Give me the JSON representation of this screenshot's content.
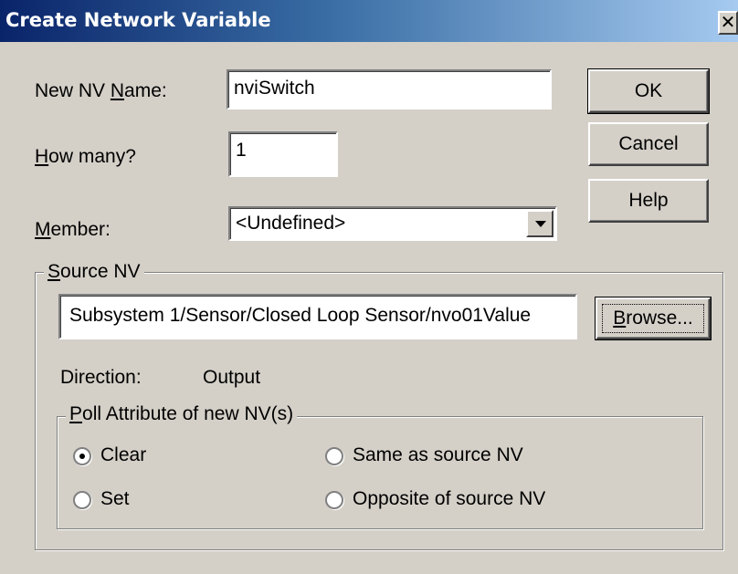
{
  "window": {
    "title": "Create Network Variable",
    "close_glyph": "✕"
  },
  "form": {
    "name_label_prefix": "New NV ",
    "name_label_mnemonic": "N",
    "name_label_suffix": "ame:",
    "name_value": "nviSwitch",
    "howmany_label_mnemonic": "H",
    "howmany_label_suffix": "ow many?",
    "howmany_value": "1",
    "member_label_mnemonic": "M",
    "member_label_suffix": "ember:",
    "member_selected": "<Undefined>"
  },
  "buttons": {
    "ok": "OK",
    "cancel": "Cancel",
    "help": "Help",
    "browse_mnemonic": "B",
    "browse_suffix": "rowse..."
  },
  "source_nv": {
    "group_mnemonic": "S",
    "group_suffix": "ource NV",
    "path": "Subsystem 1/Sensor/Closed Loop Sensor/nvo01Value",
    "direction_label": "Direction:",
    "direction_value": "Output"
  },
  "poll": {
    "group_mnemonic": "P",
    "group_suffix": "oll Attribute of new NV(s)",
    "options": [
      {
        "label": "Clear",
        "checked": true
      },
      {
        "label": "Same as source NV",
        "checked": false
      },
      {
        "label": "Set",
        "checked": false
      },
      {
        "label": "Opposite of source NV",
        "checked": false
      }
    ]
  }
}
